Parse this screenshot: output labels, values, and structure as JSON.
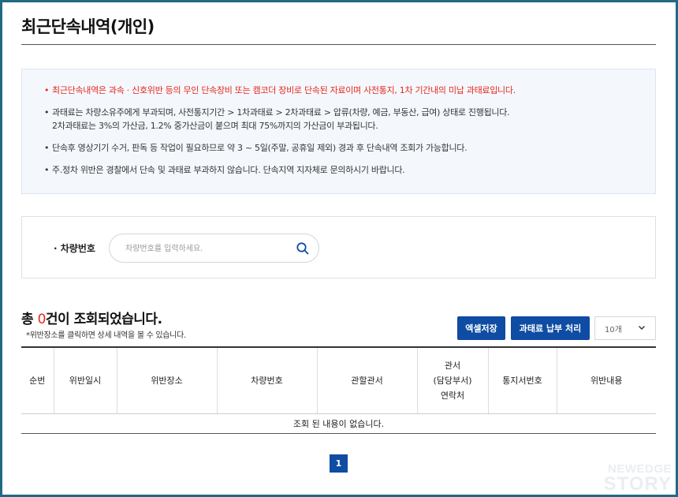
{
  "page": {
    "title": "최근단속내역(개인)"
  },
  "notice": {
    "bullet": "•",
    "items": [
      {
        "lines": [
          "최근단속내역은 과속 · 신호위반 등의 무인 단속장비 또는 캠코더 장비로 단속된 자료이며 사전통지, 1차 기간내의 미납 과태료입니다."
        ],
        "highlight": true
      },
      {
        "lines": [
          "과태료는 차량소유주에게 부과되며, 사전통지기간 > 1차과태료 > 2차과태료 > 압류(차량, 예금, 부동산, 급여) 상태로 진행됩니다.",
          "2차과태료는 3%의 가산금, 1.2% 중가산금이 붙으며 최대 75%까지의 가산금이 부과됩니다."
        ],
        "highlight": false
      },
      {
        "lines": [
          "단속후 영상기기 수거, 판독 등 작업이 필요하므로 약 3 ~ 5일(주말, 공휴일 제외) 경과 후 단속내역 조회가 가능합니다."
        ],
        "highlight": false
      },
      {
        "lines": [
          "주.정차 위반은 경찰에서 단속 및 과태료 부과하지 않습니다. 단속지역 지자체로 문의하시기 바랍니다."
        ],
        "highlight": false
      }
    ]
  },
  "search": {
    "label": "· 차량번호",
    "placeholder": "차량번호를 입력하세요.",
    "value": "",
    "icon": "search-icon"
  },
  "results": {
    "prefix": "총 ",
    "count": "0",
    "suffix": "건이 조회되었습니다.",
    "hint": "*위반장소를 클릭하면 상세 내역을 볼 수 있습니다."
  },
  "toolbar": {
    "excel_label": "엑셀저장",
    "pay_label": "과태료 납부 처리",
    "page_size": "10개",
    "page_size_icon": "chevron-down-icon"
  },
  "table": {
    "columns": [
      {
        "lines": [
          "순번"
        ]
      },
      {
        "lines": [
          "위반일시"
        ]
      },
      {
        "lines": [
          "위반장소"
        ]
      },
      {
        "lines": [
          "차량번호"
        ]
      },
      {
        "lines": [
          "관할관서"
        ]
      },
      {
        "lines": [
          "관서",
          "(담당부서)",
          "연락처"
        ]
      },
      {
        "lines": [
          "통지서번호"
        ]
      },
      {
        "lines": [
          "위반내용"
        ]
      }
    ],
    "empty_message": "조회 된 내용이 없습니다."
  },
  "pagination": {
    "current": "1"
  },
  "watermark": {
    "line1": "NEWEDGE",
    "line2": "STORY"
  },
  "colors": {
    "accent": "#0f4ca3",
    "highlight": "#e8261c",
    "frame": "#1f6b86",
    "notice_bg": "#f4f8fd"
  }
}
